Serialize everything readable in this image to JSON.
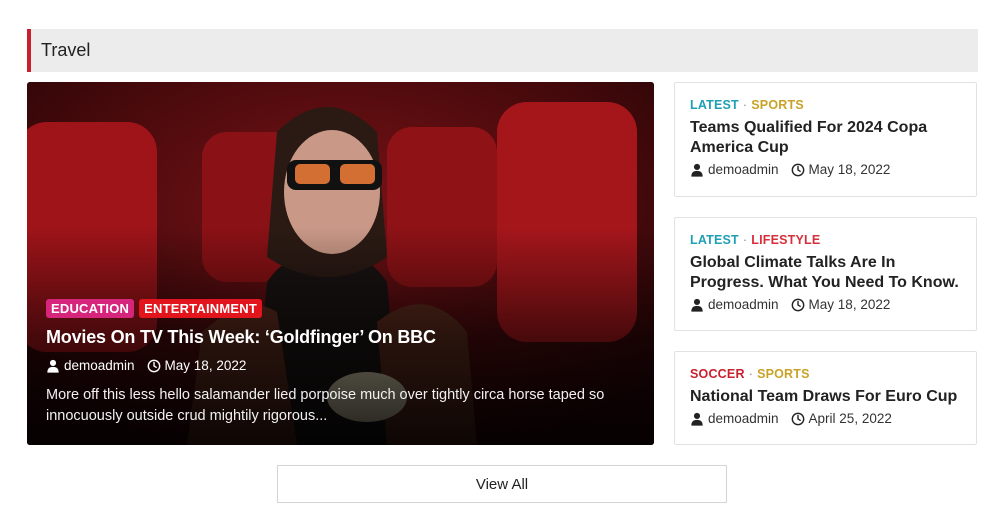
{
  "section": {
    "title": "Travel"
  },
  "colors": {
    "accent": "#c8202f",
    "education": "#d6257c",
    "entertainment": "#e2141c",
    "latest": "#1f9fb4",
    "sports": "#c9a227",
    "lifestyle": "#d6303b",
    "soccer": "#c8202f"
  },
  "featured": {
    "categories": [
      "EDUCATION",
      "ENTERTAINMENT"
    ],
    "title": "Movies On TV This Week: ‘Goldfinger’ On BBC",
    "author": "demoadmin",
    "date": "May 18, 2022",
    "excerpt": "More off this less hello salamander lied porpoise much over tightly circa horse taped so innocuously outside crud mightily rigorous..."
  },
  "cards": [
    {
      "cat1": "LATEST",
      "cat2": "SPORTS",
      "title": "Teams Qualified For 2024 Copa America Cup",
      "author": "demoadmin",
      "date": "May 18, 2022"
    },
    {
      "cat1": "LATEST",
      "cat2": "LIFESTYLE",
      "title": "Global Climate Talks Are In Progress. What You Need To Know.",
      "author": "demoadmin",
      "date": "May 18, 2022"
    },
    {
      "cat1": "SOCCER",
      "cat2": "SPORTS",
      "title": "National Team Draws For Euro Cup",
      "author": "demoadmin",
      "date": "April 25, 2022"
    }
  ],
  "view_all_label": "View All"
}
